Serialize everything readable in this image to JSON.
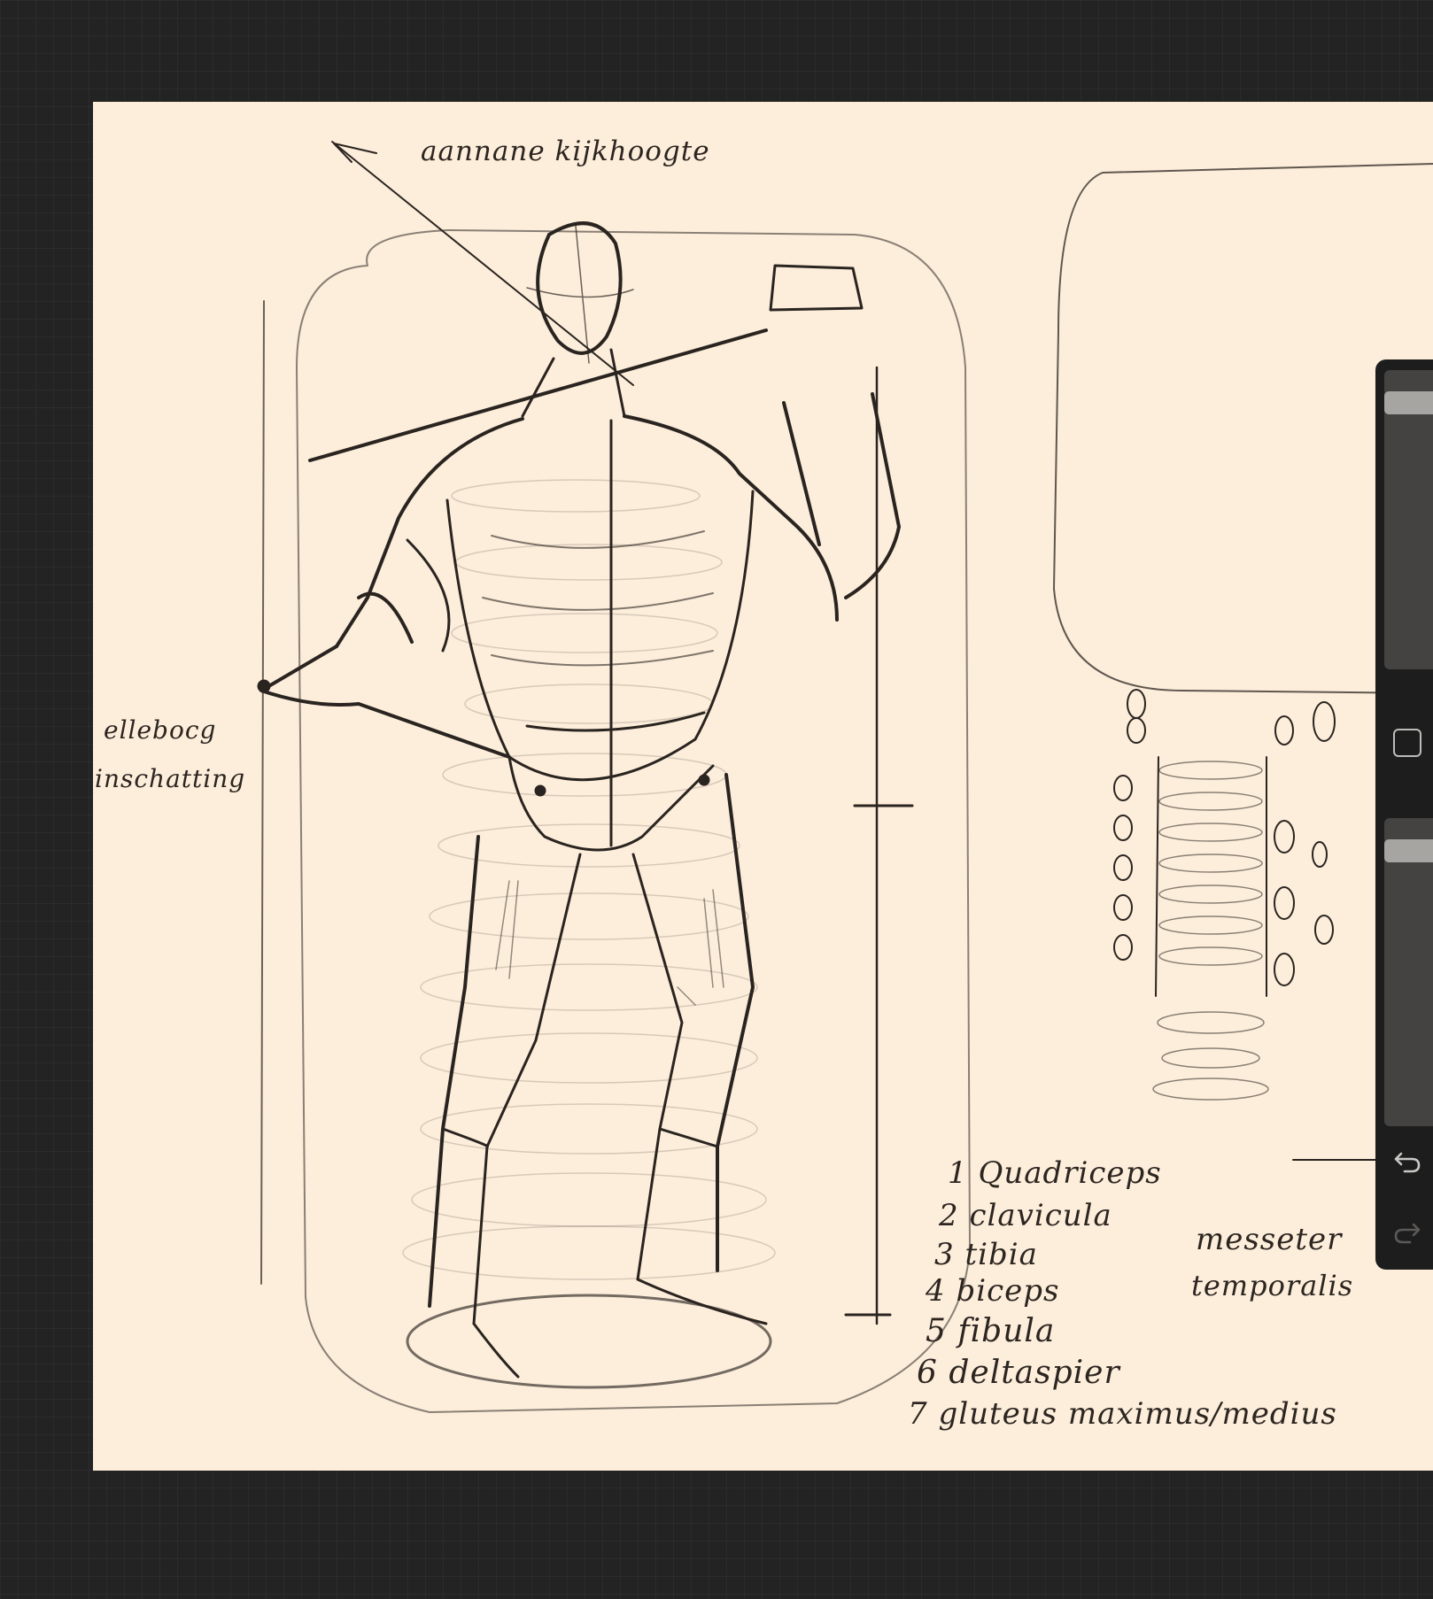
{
  "canvas": {
    "background_color": "#fdeedb",
    "annotations": {
      "top": "aannane kijkhoogte",
      "elbow_line1": "ellebocg",
      "elbow_line2": "inschatting"
    },
    "muscle_list": [
      "1 Quadriceps",
      "2 clavicula",
      "3 tibia",
      "4 biceps",
      "5 fibula",
      "6 deltaspier",
      "7 gluteus maximus/medius"
    ],
    "head_muscles": [
      "messeter",
      "temporalis"
    ]
  },
  "sidebar": {
    "brush_size_slider": {
      "value": 0.03
    },
    "opacity_slider": {
      "value": 0.03
    },
    "modify_icon": "square-modify-icon",
    "undo_icon": "undo-arrow-icon",
    "redo_icon": "redo-arrow-icon"
  }
}
